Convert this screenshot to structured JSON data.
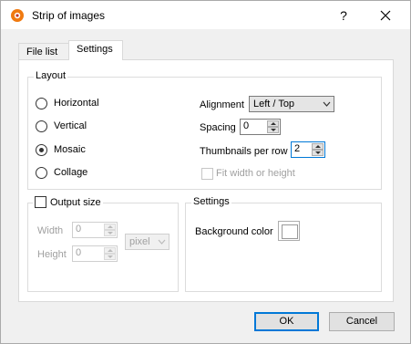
{
  "window": {
    "title": "Strip of images",
    "help_label": "?",
    "close_label": "✕"
  },
  "tabs": [
    {
      "label": "File list"
    },
    {
      "label": "Settings"
    }
  ],
  "layout_group": {
    "label": "Layout",
    "options": [
      "Horizontal",
      "Vertical",
      "Mosaic",
      "Collage"
    ],
    "selected": "Mosaic",
    "alignment_label": "Alignment",
    "alignment_value": "Left / Top",
    "spacing_label": "Spacing",
    "spacing_value": "0",
    "thumbs_label": "Thumbnails per row",
    "thumbs_value": "2",
    "fit_label": "Fit width or height"
  },
  "output_group": {
    "label": "Output size",
    "width_label": "Width",
    "width_value": "0",
    "height_label": "Height",
    "height_value": "0",
    "unit_value": "pixel"
  },
  "settings_group": {
    "label": "Settings",
    "bg_label": "Background color"
  },
  "buttons": {
    "ok": "OK",
    "cancel": "Cancel"
  },
  "colors": {
    "accent": "#0078d7",
    "background_color": "#ffffff"
  }
}
